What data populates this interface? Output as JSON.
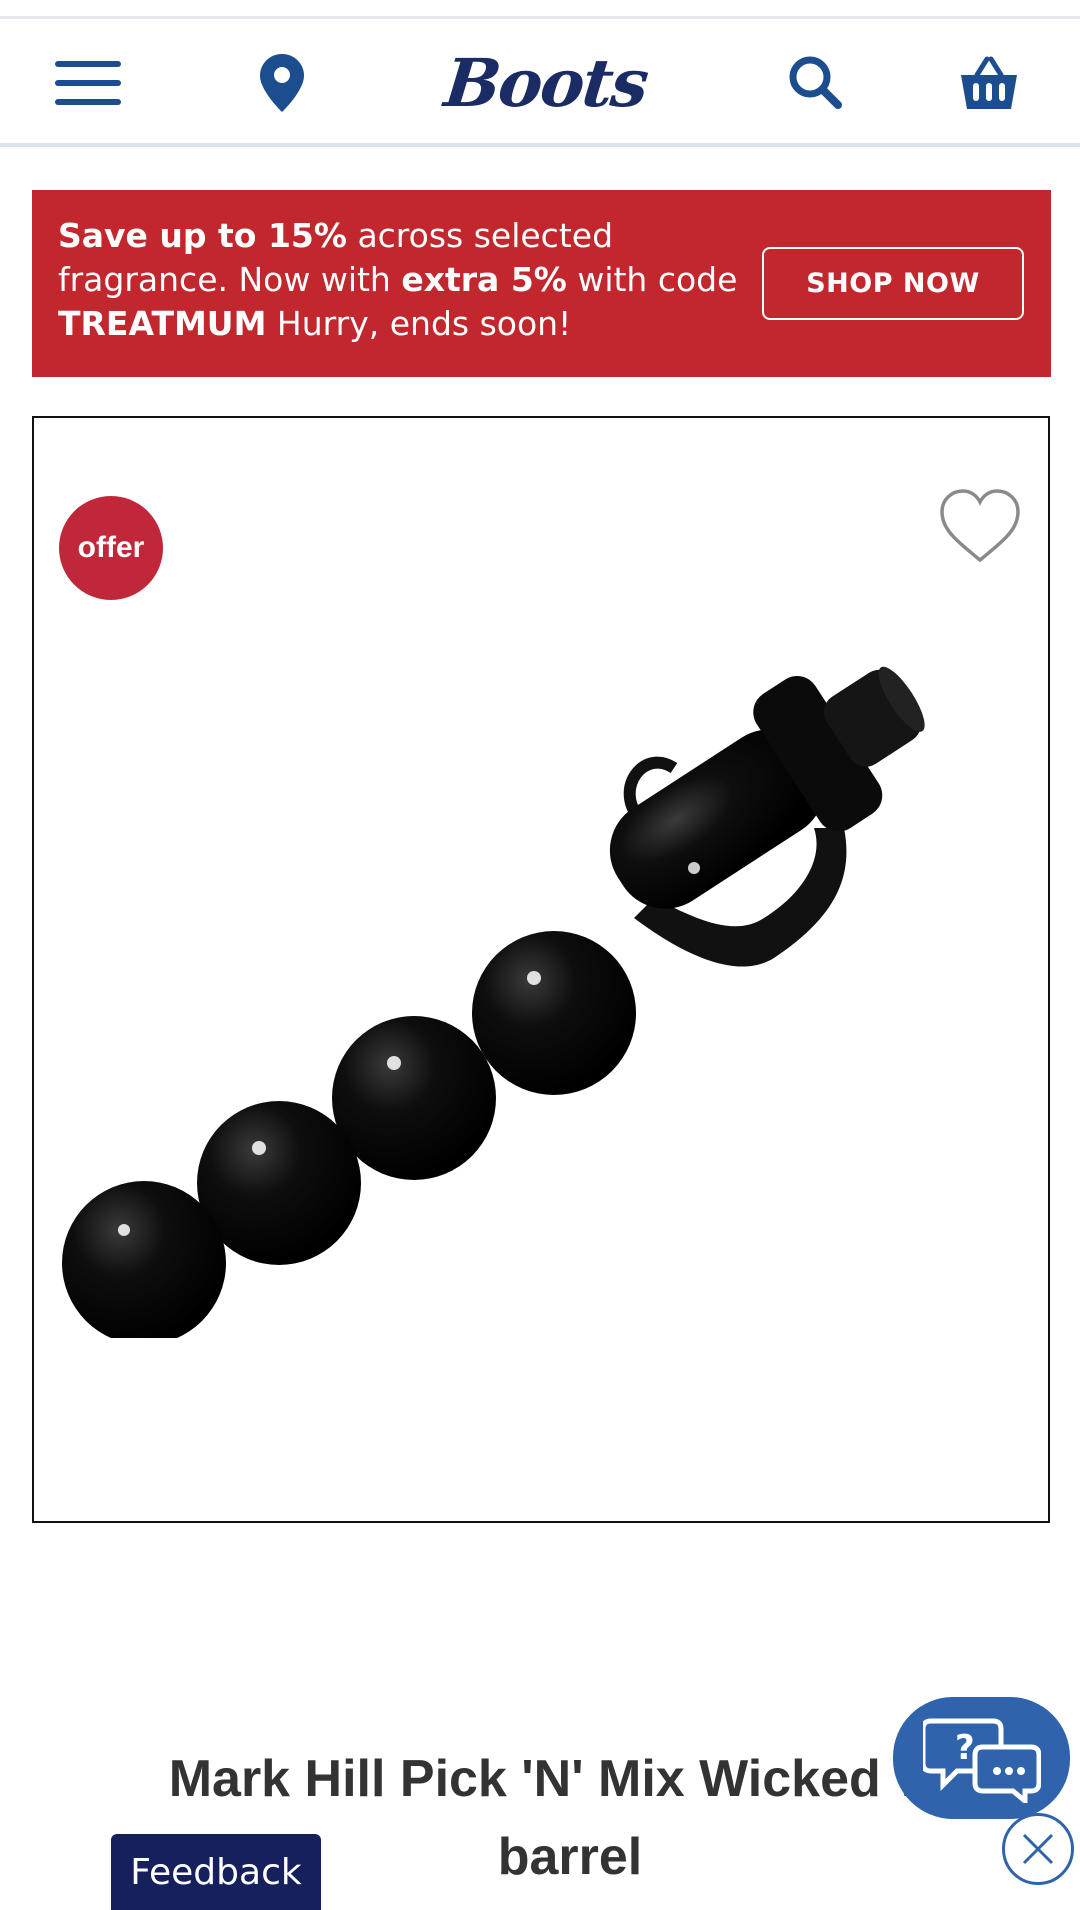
{
  "header": {
    "logo_text": "Boots",
    "icons": {
      "menu": "hamburger-menu-icon",
      "store": "location-pin-icon",
      "search": "search-icon",
      "basket": "basket-icon"
    },
    "brand_color": "#1b4d8f"
  },
  "promo": {
    "text_parts": {
      "p1_bold": "Save up to 15%",
      "p2": " across selected fragrance. Now with ",
      "p3_bold": "extra 5%",
      "p4": " with code ",
      "p5_bold": "TREATMUM",
      "p6": " Hurry, ends soon!"
    },
    "cta_label": "SHOP NOW",
    "background": "#c1272d"
  },
  "gallery": {
    "badge_label": "offer",
    "badge_color": "#c1273a",
    "favourite_icon": "heart-outline-icon",
    "image_alt": "black bubble wand curling barrel"
  },
  "product": {
    "title": "Mark Hill Pick 'N' Mix Wicked Wa\nbarrel"
  },
  "floating": {
    "feedback_label": "Feedback",
    "chat_icon": "chat-help-icon",
    "close_icon": "close-icon",
    "chat_color": "#2f63ab"
  }
}
